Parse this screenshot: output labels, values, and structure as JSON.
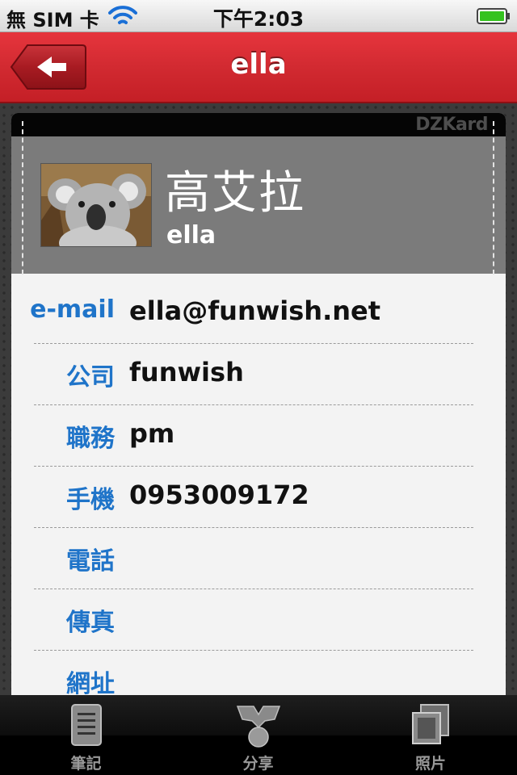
{
  "status_bar": {
    "carrier": "無 SIM 卡",
    "time": "下午2:03"
  },
  "nav": {
    "title": "ella",
    "back_icon": "arrow-left-icon"
  },
  "card": {
    "brand": "DZKard",
    "name_main": "高艾拉",
    "name_sub": "ella",
    "fields": [
      {
        "label": "e-mail",
        "value": "ella@funwish.net"
      },
      {
        "label": "公司",
        "value": "funwish"
      },
      {
        "label": "職務",
        "value": "pm"
      },
      {
        "label": "手機",
        "value": "0953009172"
      },
      {
        "label": "電話",
        "value": ""
      },
      {
        "label": "傳真",
        "value": ""
      },
      {
        "label": "網址",
        "value": ""
      }
    ]
  },
  "tabs": [
    {
      "label": "筆記",
      "icon": "notes-icon"
    },
    {
      "label": "分享",
      "icon": "share-icon"
    },
    {
      "label": "照片",
      "icon": "photos-icon"
    }
  ],
  "colors": {
    "nav_red": "#d22a31",
    "label_blue": "#1f74c9",
    "header_gray": "#7b7b7b"
  }
}
